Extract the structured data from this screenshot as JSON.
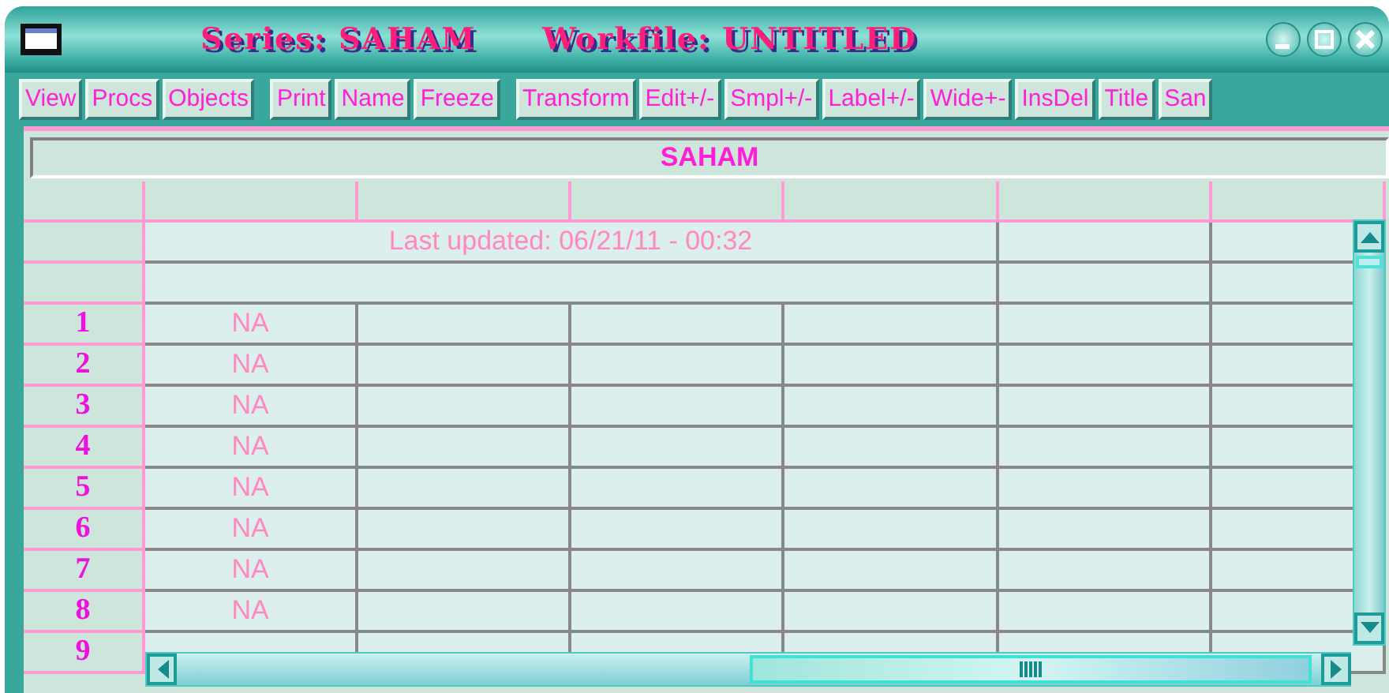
{
  "window": {
    "title_series": "Series: SAHAM",
    "title_workfile": "Workfile: UNTITLED"
  },
  "toolbar": {
    "groups": [
      [
        "View",
        "Procs",
        "Objects"
      ],
      [
        "Print",
        "Name",
        "Freeze"
      ],
      [
        "Transform",
        "Edit+/-",
        "Smpl+/-",
        "Label+/-",
        "Wide+-",
        "InsDel",
        "Title",
        "San"
      ]
    ]
  },
  "spreadsheet": {
    "series_name": "SAHAM",
    "last_updated": "Last updated: 06/21/11 - 00:32",
    "rows": [
      {
        "label": "1",
        "value": "NA"
      },
      {
        "label": "2",
        "value": "NA"
      },
      {
        "label": "3",
        "value": "NA"
      },
      {
        "label": "4",
        "value": "NA"
      },
      {
        "label": "5",
        "value": "NA"
      },
      {
        "label": "6",
        "value": "NA"
      },
      {
        "label": "7",
        "value": "NA"
      },
      {
        "label": "8",
        "value": "NA"
      },
      {
        "label": "9"
      }
    ]
  }
}
